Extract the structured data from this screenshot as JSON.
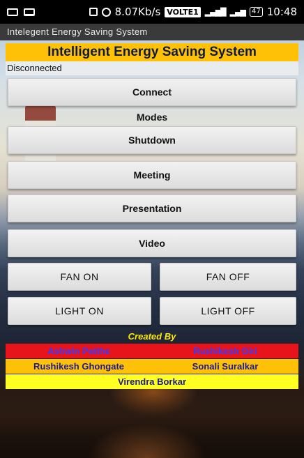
{
  "status_bar": {
    "speed": "8.07Kb/s",
    "volte": "VOLTE1",
    "signal1": "4G",
    "battery": "47",
    "time": "10:48"
  },
  "app_bar": {
    "title": "Intelegent Energy Saving System"
  },
  "header": {
    "title": "Intelligent Energy Saving System",
    "connection_status": "Disconnected"
  },
  "buttons": {
    "connect": "Connect",
    "modes_label": "Modes",
    "shutdown": "Shutdown",
    "meeting": "Meeting",
    "presentation": "Presentation",
    "video": "Video",
    "fan_on": "FAN ON",
    "fan_off": "FAN OFF",
    "light_on": "LIGHT ON",
    "light_off": "LIGHT OFF"
  },
  "credits": {
    "label": "Created By",
    "names": [
      "Ashwin Patthe",
      "Rushikesh Giri",
      "Rushikesh Ghongate",
      "Sonali Suralkar",
      "Virendra Borkar"
    ]
  },
  "colors": {
    "banner": "#ffc107",
    "row1_bg": "#e8141c",
    "row2_bg": "#ffc107",
    "row3_bg": "#ffff22",
    "credit_text": "#1a1a9c"
  }
}
